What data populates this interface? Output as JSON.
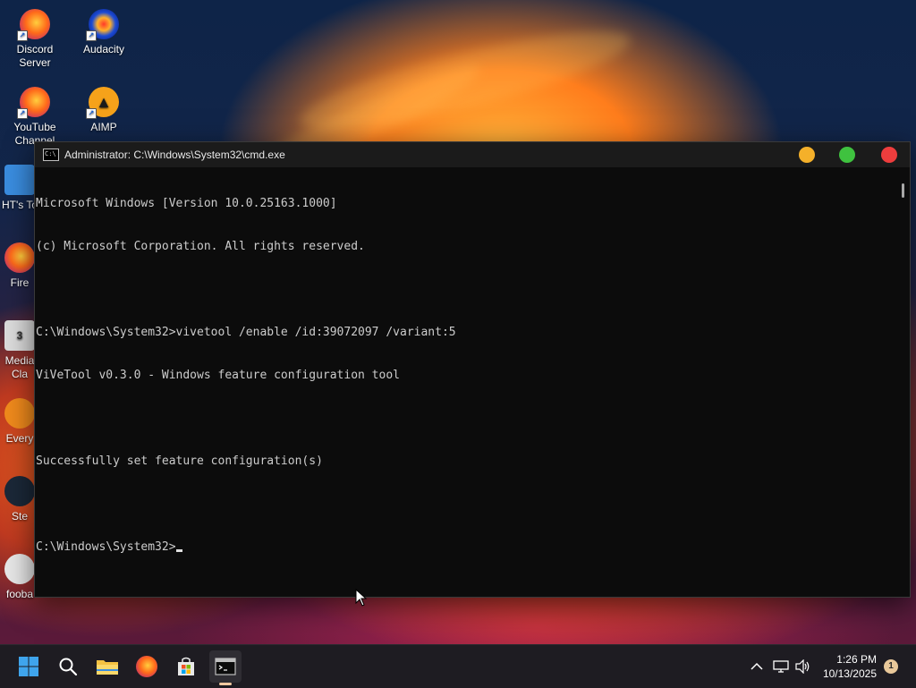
{
  "desktop": {
    "icons": [
      {
        "label": "Discord\nServer",
        "icon": "firefox-shortcut-icon"
      },
      {
        "label": "Audacity",
        "icon": "audacity-icon"
      },
      {
        "label": "YouTube\nChannel",
        "icon": "firefox-shortcut-icon"
      },
      {
        "label": "AIMP",
        "icon": "aimp-icon"
      },
      {
        "label": "HT's To",
        "icon": "folder-icon"
      },
      {
        "label": "Fire",
        "icon": "firefox-icon"
      },
      {
        "label": "Media\nCla",
        "icon": "media-player-icon"
      },
      {
        "label": "Every",
        "icon": "search-everything-icon"
      },
      {
        "label": "Ste",
        "icon": "steam-icon"
      },
      {
        "label": "fooba",
        "icon": "foobar-icon"
      }
    ]
  },
  "cmd_window": {
    "title": "Administrator: C:\\Windows\\System32\\cmd.exe",
    "lines": [
      "Microsoft Windows [Version 10.0.25163.1000]",
      "(c) Microsoft Corporation. All rights reserved.",
      "",
      "C:\\Windows\\System32>vivetool /enable /id:39072097 /variant:5",
      "ViVeTool v0.3.0 - Windows feature configuration tool",
      "",
      "Successfully set feature configuration(s)",
      ""
    ],
    "prompt": "C:\\Windows\\System32>",
    "controls": {
      "minimize_color": "#f4b02a",
      "maximize_color": "#3fc23f",
      "close_color": "#ee3d3d"
    }
  },
  "taskbar": {
    "apps": [
      "windows-start-icon",
      "search-icon",
      "file-explorer-icon",
      "firefox-icon",
      "microsoft-store-icon",
      "terminal-icon"
    ],
    "active_app": "terminal-icon",
    "tray": {
      "chevron": "^",
      "time": "1:26 PM",
      "date": "10/13/2025",
      "notification_count": "1"
    }
  }
}
